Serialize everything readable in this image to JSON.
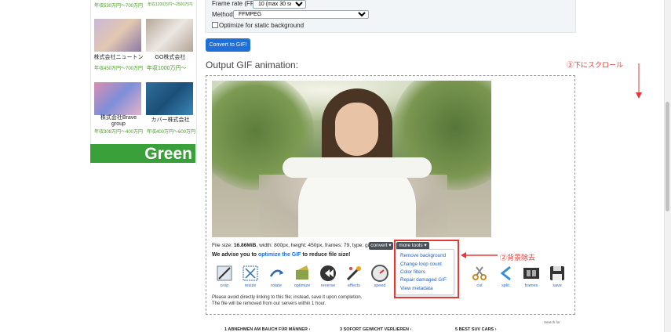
{
  "ads": {
    "top_salary_left": "年収530万円～700万円",
    "top_salary_right": "年収1200万円～2500万円",
    "companies": [
      {
        "name": "株式会社ニュートン",
        "salary": "年収450万円～700万円"
      },
      {
        "name": "GO株式会社",
        "salary": "年収1000万円～"
      },
      {
        "name": "株式会社Brave group",
        "salary": "年収308万円～400万円"
      },
      {
        "name": "カバー株式会社",
        "salary": "年収400万円～600万円"
      }
    ],
    "banner": "Green"
  },
  "form": {
    "frame_rate_label": "Frame rate (FPS):",
    "frame_rate_value": "10 (max 30 seconds)",
    "method_label": "Method:",
    "method_value": "FFMPEG",
    "optimize_label": "Optimize for static background",
    "convert_button": "Convert to GIF!"
  },
  "output": {
    "title": "Output GIF animation:",
    "meta_prefix": "File size: ",
    "file_size": "16.86MiB",
    "meta_suffix": ", width: 800px, height: 450px, frames: 79, type: gif",
    "convert_btn": "convert ▾",
    "more_tools_btn": "more tools ▾",
    "advise_prefix": "We advise you to ",
    "advise_link": "optimize the GIF",
    "advise_suffix": " to reduce file size!",
    "notice_line1": "Please avoid directly linking to this file; instead, save it upon completion.",
    "notice_line2": "The file will be removed from our servers within 1 hour."
  },
  "tools": [
    "crop",
    "resize",
    "rotate",
    "optimize",
    "reverse",
    "effects",
    "speed",
    "",
    "cut",
    "split",
    "frames",
    "save"
  ],
  "more_tools_menu": [
    "Remove background",
    "Change loop count",
    "Color filters",
    "Repair damaged GIF",
    "View metadata"
  ],
  "annotations": {
    "scroll_note": "③下にスクロール",
    "bg_note": "②背景除去"
  },
  "bottom_ads": {
    "search_for": "Search for",
    "items": [
      "1   ABNEHMEN AM BAUCH FÜR MÄNNER   ›",
      "3   SOFORT GEWICHT VERLIEREN   ›",
      "5   BEST SUV CARS   ›"
    ]
  },
  "colors": {
    "accent": "#1f6fd8",
    "annotation": "#e53935",
    "green": "#3aa03a"
  }
}
